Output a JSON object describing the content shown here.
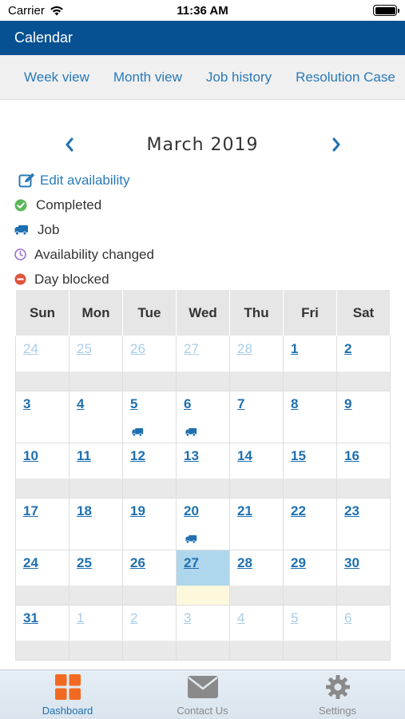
{
  "status": {
    "carrier": "Carrier",
    "time": "11:36 AM"
  },
  "header": {
    "title": "Calendar"
  },
  "tabs": [
    {
      "label": "Week view"
    },
    {
      "label": "Month view"
    },
    {
      "label": "Job history"
    },
    {
      "label": "Resolution Case"
    }
  ],
  "calendar": {
    "month_title": "March 2019",
    "weekdays": [
      "Sun",
      "Mon",
      "Tue",
      "Wed",
      "Thu",
      "Fri",
      "Sat"
    ],
    "weeks": [
      [
        {
          "d": "24",
          "m": true
        },
        {
          "d": "25",
          "m": true
        },
        {
          "d": "26",
          "m": true
        },
        {
          "d": "27",
          "m": true
        },
        {
          "d": "28",
          "m": true
        },
        {
          "d": "1"
        },
        {
          "d": "2"
        }
      ],
      [
        {
          "d": "3"
        },
        {
          "d": "4"
        },
        {
          "d": "5",
          "job": true
        },
        {
          "d": "6",
          "job": true
        },
        {
          "d": "7"
        },
        {
          "d": "8"
        },
        {
          "d": "9"
        }
      ],
      [
        {
          "d": "10"
        },
        {
          "d": "11"
        },
        {
          "d": "12"
        },
        {
          "d": "13"
        },
        {
          "d": "14"
        },
        {
          "d": "15"
        },
        {
          "d": "16"
        }
      ],
      [
        {
          "d": "17"
        },
        {
          "d": "18"
        },
        {
          "d": "19"
        },
        {
          "d": "20",
          "job": true
        },
        {
          "d": "21"
        },
        {
          "d": "22"
        },
        {
          "d": "23"
        }
      ],
      [
        {
          "d": "24"
        },
        {
          "d": "25"
        },
        {
          "d": "26"
        },
        {
          "d": "27",
          "today": true
        },
        {
          "d": "28"
        },
        {
          "d": "29"
        },
        {
          "d": "30"
        }
      ],
      [
        {
          "d": "31"
        },
        {
          "d": "1",
          "m": true
        },
        {
          "d": "2",
          "m": true
        },
        {
          "d": "3",
          "m": true
        },
        {
          "d": "4",
          "m": true
        },
        {
          "d": "5",
          "m": true
        },
        {
          "d": "6",
          "m": true
        }
      ]
    ]
  },
  "legend": {
    "edit_availability": "Edit availability",
    "completed": "Completed",
    "job": "Job",
    "availability_changed": "Availability changed",
    "day_blocked": "Day blocked"
  },
  "tab_bar": [
    {
      "label": "Dashboard",
      "icon": "dashboard-icon",
      "active": true
    },
    {
      "label": "Contact Us",
      "icon": "envelope-icon"
    },
    {
      "label": "Settings",
      "icon": "gear-icon"
    }
  ],
  "colors": {
    "header_bg": "#075192",
    "link": "#1f70b0",
    "dashboard_orange": "#f26a21",
    "completed_green": "#5cb85c",
    "availability_purple": "#9b6fd4",
    "blocked_red": "#e0533c",
    "today_highlight": "#aed6ec"
  }
}
